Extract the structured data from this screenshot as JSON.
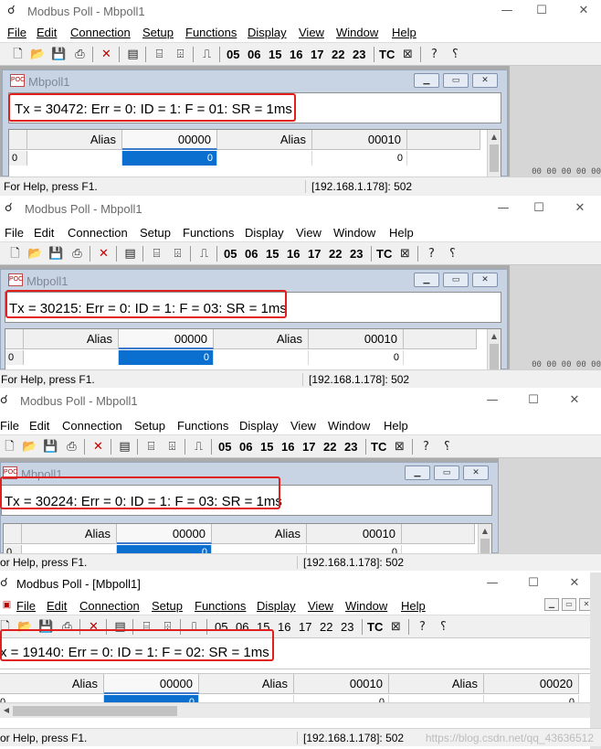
{
  "windows": [
    {
      "title": "Modbus Poll - Mbpoll1",
      "menu": [
        "File",
        "Edit",
        "Connection",
        "Setup",
        "Functions",
        "Display",
        "View",
        "Window",
        "Help"
      ],
      "toolbar_codes": [
        "05",
        "06",
        "15",
        "16",
        "17",
        "22",
        "23"
      ],
      "toolbar_tc": "TC",
      "child_title": "Mbpoll1",
      "status_line": "Tx = 30472: Err = 0: ID = 1: F = 01: SR = 1ms",
      "columns": [
        {
          "header": "Alias",
          "value": ""
        },
        {
          "header": "00000",
          "value": "0"
        },
        {
          "header": "Alias",
          "value": ""
        },
        {
          "header": "00010",
          "value": "0"
        }
      ],
      "row_label": "0",
      "help_text": "For Help, press F1.",
      "connection": "[192.168.1.178]: 502"
    },
    {
      "title": "Modbus Poll - Mbpoll1",
      "menu": [
        "File",
        "Edit",
        "Connection",
        "Setup",
        "Functions",
        "Display",
        "View",
        "Window",
        "Help"
      ],
      "toolbar_codes": [
        "05",
        "06",
        "15",
        "16",
        "17",
        "22",
        "23"
      ],
      "toolbar_tc": "TC",
      "child_title": "Mbpoll1",
      "status_line": "Tx = 30215: Err = 0: ID = 1: F = 03: SR = 1ms",
      "columns": [
        {
          "header": "Alias",
          "value": ""
        },
        {
          "header": "00000",
          "value": "0"
        },
        {
          "header": "Alias",
          "value": ""
        },
        {
          "header": "00010",
          "value": "0"
        }
      ],
      "row_label": "0",
      "help_text": "For Help, press F1.",
      "connection": "[192.168.1.178]: 502"
    },
    {
      "title": "Modbus Poll - Mbpoll1",
      "menu": [
        "File",
        "Edit",
        "Connection",
        "Setup",
        "Functions",
        "Display",
        "View",
        "Window",
        "Help"
      ],
      "toolbar_codes": [
        "05",
        "06",
        "15",
        "16",
        "17",
        "22",
        "23"
      ],
      "toolbar_tc": "TC",
      "child_title": "Mbpoll1",
      "status_line": "Tx = 30224: Err = 0: ID = 1: F = 03: SR = 1ms",
      "columns": [
        {
          "header": "Alias",
          "value": ""
        },
        {
          "header": "00000",
          "value": "0"
        },
        {
          "header": "Alias",
          "value": ""
        },
        {
          "header": "00010",
          "value": "0"
        }
      ],
      "row_label": "0",
      "help_text": "or Help, press F1.",
      "connection": "[192.168.1.178]: 502"
    },
    {
      "title": "Modbus Poll - [Mbpoll1]",
      "menu": [
        "File",
        "Edit",
        "Connection",
        "Setup",
        "Functions",
        "Display",
        "View",
        "Window",
        "Help"
      ],
      "toolbar_codes": [
        "05",
        "06",
        "15",
        "16",
        "17",
        "22",
        "23"
      ],
      "toolbar_tc": "TC",
      "status_line": "x = 19140: Err = 0: ID = 1: F = 02: SR = 1ms",
      "columns": [
        {
          "header": "Alias",
          "value": ""
        },
        {
          "header": "00000",
          "value": "0"
        },
        {
          "header": "Alias",
          "value": ""
        },
        {
          "header": "00010",
          "value": "0"
        },
        {
          "header": "Alias",
          "value": ""
        },
        {
          "header": "00020",
          "value": "0"
        }
      ],
      "row_label": "0",
      "help_text": "or Help, press F1.",
      "connection": "[192.168.1.178]: 502",
      "watermark": "https://blog.csdn.net/qq_43636512"
    }
  ],
  "icons": {
    "app": "modbus-app-icon",
    "new": "new-file-icon",
    "open": "open-folder-icon",
    "save": "save-disk-icon",
    "print": "print-icon",
    "close": "close-red-x-icon",
    "window": "window-icon",
    "connect": "connect-icon",
    "disconnect": "disconnect-icon",
    "pulse": "pulse-icon",
    "register": "register-icon",
    "help": "help-question-icon",
    "context-help": "context-help-icon"
  },
  "colors": {
    "highlight_box": "#e0201e",
    "selected_cell": "#0a6fce",
    "mdi_background": "#ababab"
  },
  "background_text": "00 00 00 00 00"
}
